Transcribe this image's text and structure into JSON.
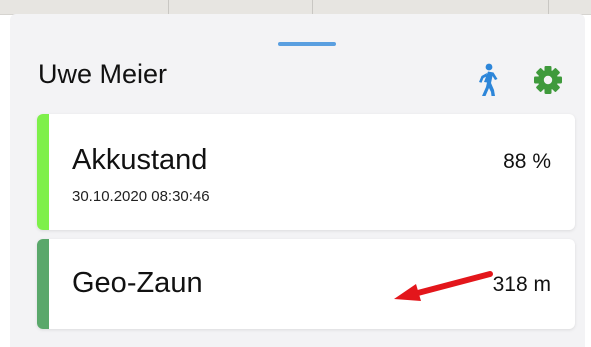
{
  "header": {
    "name": "Uwe Meier",
    "walk_icon": "walking-person-icon",
    "settings_icon": "gear-icon"
  },
  "cards": {
    "battery": {
      "label": "Akkustand",
      "value": "88 %",
      "level_percent": 88,
      "timestamp": "30.10.2020 08:30:46",
      "accent_color": "#7ef04a"
    },
    "geofence": {
      "label": "Geo-Zaun",
      "value": "318 m",
      "accent_color": "#5aa86b"
    }
  },
  "annotation": {
    "arrow_color": "#e3161b",
    "points_to": "cards.geofence"
  },
  "colors": {
    "accent_blue": "#5a9fe0",
    "settings_green": "#3f9a3c"
  }
}
